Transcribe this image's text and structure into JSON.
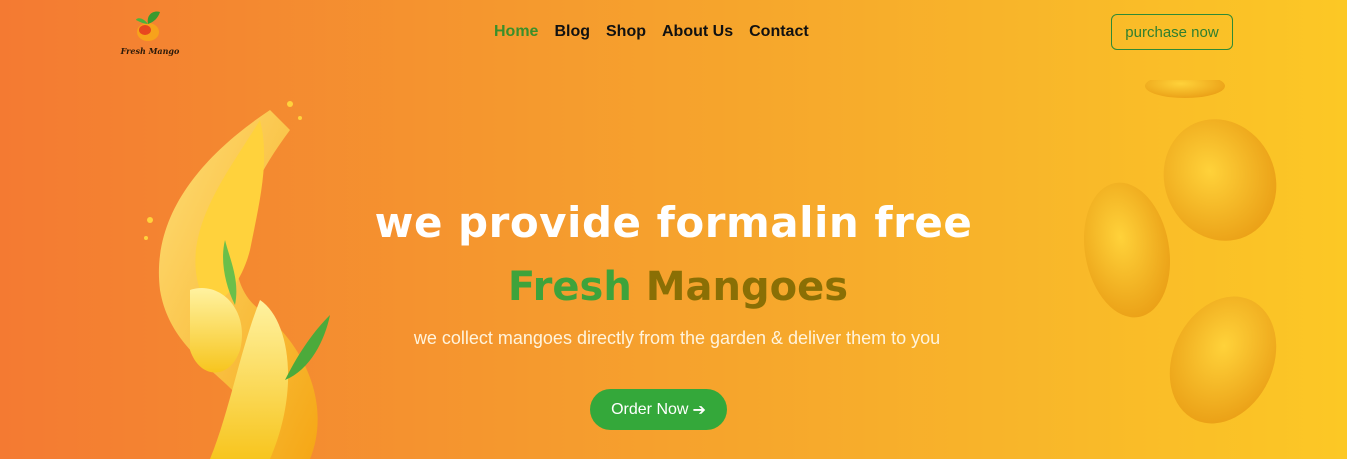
{
  "brand": {
    "logo_text": "Fresh Mango",
    "logo_icon": "mango-logo-icon"
  },
  "nav": {
    "items": [
      {
        "label": "Home",
        "active": true
      },
      {
        "label": "Blog",
        "active": false
      },
      {
        "label": "Shop",
        "active": false
      },
      {
        "label": "About Us",
        "active": false
      },
      {
        "label": "Contact",
        "active": false
      }
    ]
  },
  "header": {
    "cta_label": "purchase now"
  },
  "hero": {
    "headline": "we provide formalin free",
    "highlight_word1": "Fresh",
    "highlight_word2": "Mangoes",
    "subtitle": "we collect mangoes directly from the garden & deliver them to you",
    "button_label": "Order Now",
    "button_icon": "arrow-right-icon"
  },
  "colors": {
    "accent_green": "#34a83a",
    "mango_brown": "#8a6f05",
    "bg_start": "#f47a32",
    "bg_end": "#fcc825"
  }
}
